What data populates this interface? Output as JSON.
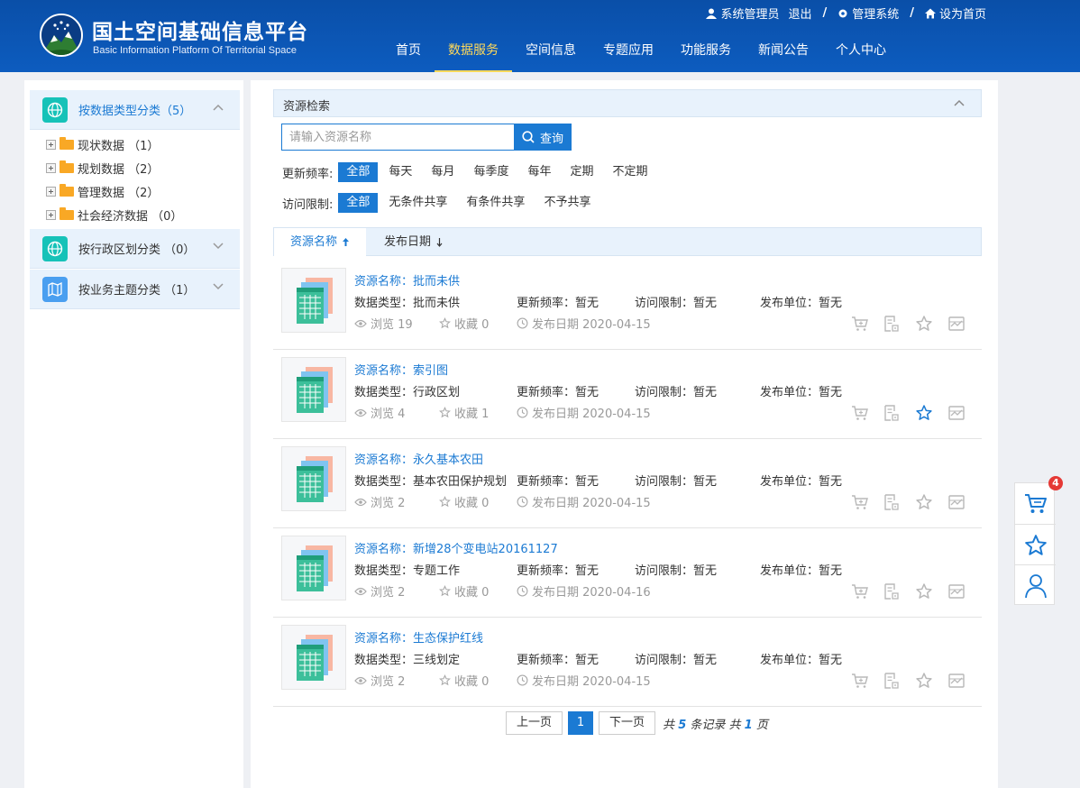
{
  "brand": {
    "title": "国土空间基础信息平台",
    "subtitle": "Basic Information  Platform Of Territorial Space"
  },
  "topbar": {
    "user": "系统管理员",
    "logout": "退出",
    "admin": "管理系统",
    "home": "设为首页"
  },
  "nav": [
    "首页",
    "数据服务",
    "空间信息",
    "专题应用",
    "功能服务",
    "新闻公告",
    "个人中心"
  ],
  "nav_active": "数据服务",
  "sidebar": {
    "section1": {
      "label": "按数据类型分类（5）"
    },
    "tree": [
      {
        "label": "现状数据 （1）"
      },
      {
        "label": "规划数据 （2）"
      },
      {
        "label": "管理数据 （2）"
      },
      {
        "label": "社会经济数据 （0）"
      }
    ],
    "section2": {
      "label": "按行政区划分类 （0）"
    },
    "section3": {
      "label": "按业务主题分类 （1）"
    }
  },
  "search": {
    "panel_title": "资源检索",
    "placeholder": "请输入资源名称",
    "button": "查询"
  },
  "filters": {
    "freq_label": "更新频率:",
    "freq": [
      "全部",
      "每天",
      "每月",
      "每季度",
      "每年",
      "定期",
      "不定期"
    ],
    "access_label": "访问限制:",
    "access": [
      "全部",
      "无条件共享",
      "有条件共享",
      "不予共享"
    ]
  },
  "sort": {
    "name": "资源名称",
    "date": "发布日期"
  },
  "results": [
    {
      "title": "资源名称：批而未供",
      "type": "数据类型：批而未供",
      "freq": "更新频率：暂无",
      "access": "访问限制：暂无",
      "unit": "发布单位：暂无",
      "views": "浏览 19",
      "favs": "收藏 0",
      "date": "发布日期  2020-04-15",
      "starred": false
    },
    {
      "title": "资源名称：索引图",
      "type": "数据类型：行政区划",
      "freq": "更新频率：暂无",
      "access": "访问限制：暂无",
      "unit": "发布单位：暂无",
      "views": "浏览 4",
      "favs": "收藏 1",
      "date": "发布日期  2020-04-15",
      "starred": true
    },
    {
      "title": "资源名称：永久基本农田",
      "type": "数据类型：基本农田保护规划",
      "freq": "更新频率：暂无",
      "access": "访问限制：暂无",
      "unit": "发布单位：暂无",
      "views": "浏览 2",
      "favs": "收藏 0",
      "date": "发布日期  2020-04-15",
      "starred": false
    },
    {
      "title": "资源名称：新增28个变电站20161127",
      "type": "数据类型：专题工作",
      "freq": "更新频率：暂无",
      "access": "访问限制：暂无",
      "unit": "发布单位：暂无",
      "views": "浏览 2",
      "favs": "收藏 0",
      "date": "发布日期  2020-04-16",
      "starred": false
    },
    {
      "title": "资源名称：生态保护红线",
      "type": "数据类型：三线划定",
      "freq": "更新频率：暂无",
      "access": "访问限制：暂无",
      "unit": "发布单位：暂无",
      "views": "浏览 2",
      "favs": "收藏 0",
      "date": "发布日期  2020-04-15",
      "starred": false
    }
  ],
  "pager": {
    "prev": "上一页",
    "page": "1",
    "next": "下一页",
    "info_pre": "共",
    "total": "5",
    "info_mid": "条记录 共",
    "pages": "1",
    "info_post": "页"
  },
  "cart_count": "4",
  "colors": {
    "primary": "#1b7ad3",
    "header": "#0d5cbf",
    "nav_active": "#ffd95a",
    "teal_icon": "#16c2b8"
  }
}
